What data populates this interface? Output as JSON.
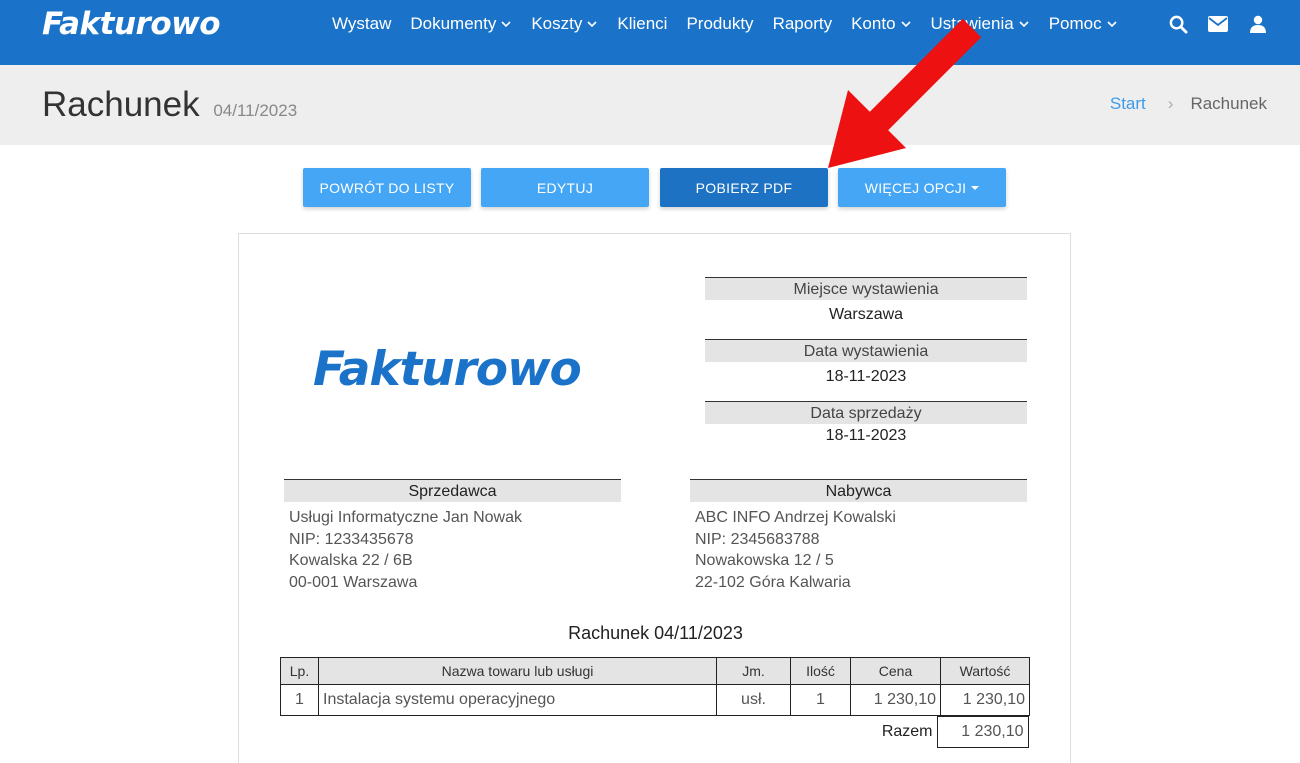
{
  "nav": {
    "brand": "Fakturowo",
    "items": [
      {
        "label": "Wystaw",
        "dropdown": false
      },
      {
        "label": "Dokumenty",
        "dropdown": true
      },
      {
        "label": "Koszty",
        "dropdown": true
      },
      {
        "label": "Klienci",
        "dropdown": false
      },
      {
        "label": "Produkty",
        "dropdown": false
      },
      {
        "label": "Raporty",
        "dropdown": false
      },
      {
        "label": "Konto",
        "dropdown": true
      },
      {
        "label": "Ustawienia",
        "dropdown": true
      },
      {
        "label": "Pomoc",
        "dropdown": true
      }
    ],
    "icons": [
      "search-icon",
      "envelope-icon",
      "user-icon"
    ]
  },
  "header": {
    "title": "Rachunek",
    "subtitle": "04/11/2023",
    "breadcrumb": {
      "home": "Start",
      "current": "Rachunek"
    }
  },
  "actions": {
    "back": "POWRÓT DO LISTY",
    "edit": "EDYTUJ",
    "pdf": "POBIERZ PDF",
    "more": "WIĘCEJ OPCJI"
  },
  "document": {
    "logo": "Fakturowo",
    "place_label": "Miejsce wystawienia",
    "place_value": "Warszawa",
    "issue_date_label": "Data wystawienia",
    "issue_date_value": "18-11-2023",
    "sale_date_label": "Data sprzedaży",
    "sale_date_value": "18-11-2023",
    "seller": {
      "label": "Sprzedawca",
      "lines": [
        "Usługi Informatyczne Jan Nowak",
        "NIP: 1233435678",
        "Kowalska 22 / 6B",
        "00-001 Warszawa"
      ]
    },
    "buyer": {
      "label": "Nabywca",
      "lines": [
        "ABC INFO Andrzej Kowalski",
        "NIP: 2345683788",
        "Nowakowska 12 / 5",
        "22-102 Góra Kalwaria"
      ]
    },
    "title": "Rachunek 04/11/2023",
    "table": {
      "headers": [
        "Lp.",
        "Nazwa towaru lub usługi",
        "Jm.",
        "Ilość",
        "Cena",
        "Wartość"
      ],
      "rows": [
        [
          "1",
          "Instalacja systemu operacyjnego",
          "usł.",
          "1",
          "1 230,10",
          "1 230,10"
        ]
      ],
      "total_label": "Razem",
      "total_value": "1 230,10"
    }
  },
  "colors": {
    "nav_bg": "#1a73c8",
    "button": "#45a6f5",
    "button_active": "#1e72c4",
    "arrow": "#ee1111"
  }
}
